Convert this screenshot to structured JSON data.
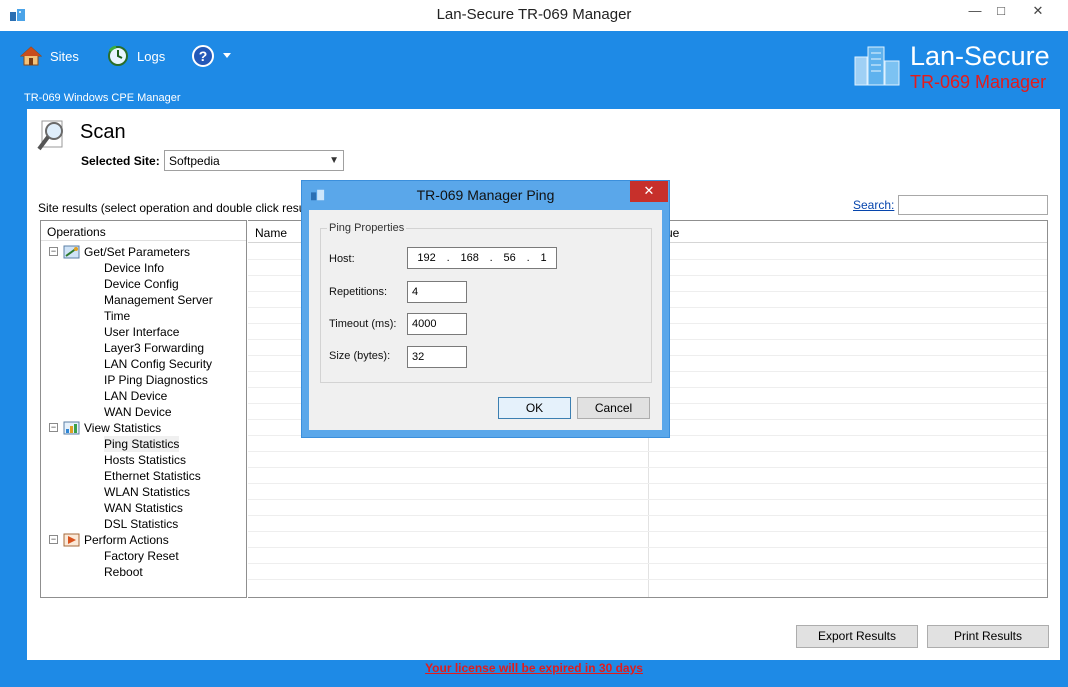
{
  "window": {
    "title": "Lan-Secure TR-069 Manager",
    "minimize_label": "—",
    "maximize_label": "□",
    "close_label": "✕"
  },
  "toolbar": {
    "sites_label": "Sites",
    "logs_label": "Logs",
    "help_icon": "question-icon"
  },
  "subtitle": "TR-069 Windows CPE Manager",
  "brand": {
    "line1": "Lan-Secure",
    "line2": "TR-069 Manager",
    "line2_color": "#e41b1b"
  },
  "scan": {
    "title": "Scan",
    "selected_site_label": "Selected Site:",
    "selected_site_value": "Softpedia",
    "results_label": "Site results (select operation and double click results for",
    "search_label": "Search:",
    "search_value": ""
  },
  "operations": {
    "header": "Operations",
    "groups": [
      {
        "label": "Get/Set Parameters",
        "expander": "−",
        "items": [
          "Device Info",
          "Device Config",
          "Management Server",
          "Time",
          "User Interface",
          "Layer3 Forwarding",
          "LAN Config Security",
          "IP Ping Diagnostics",
          "LAN Device",
          "WAN Device"
        ]
      },
      {
        "label": "View Statistics",
        "expander": "−",
        "items": [
          "Ping Statistics",
          "Hosts Statistics",
          "Ethernet Statistics",
          "WLAN Statistics",
          "WAN Statistics",
          "DSL Statistics"
        ]
      },
      {
        "label": "Perform Actions",
        "expander": "−",
        "items": [
          "Factory Reset",
          "Reboot"
        ]
      }
    ],
    "selected_item": "Ping Statistics"
  },
  "grid": {
    "columns": [
      "Name",
      "ue"
    ]
  },
  "buttons": {
    "export": "Export Results",
    "print": "Print Results"
  },
  "license": "Your license will be expired in 30 days",
  "dialog": {
    "title": "TR-069 Manager Ping",
    "close_label": "✕",
    "group_label": "Ping Properties",
    "host_label": "Host:",
    "host_octets": [
      "192",
      "168",
      "56",
      "1"
    ],
    "host_dot": ".",
    "repetitions_label": "Repetitions:",
    "repetitions_value": "4",
    "timeout_label": "Timeout (ms):",
    "timeout_value": "4000",
    "size_label": "Size (bytes):",
    "size_value": "32",
    "ok_label": "OK",
    "cancel_label": "Cancel"
  },
  "colors": {
    "accent": "#1e8ae6",
    "alert": "#e41b1b",
    "dialog_frame": "#5aa7ea",
    "close_red": "#c7302b"
  }
}
